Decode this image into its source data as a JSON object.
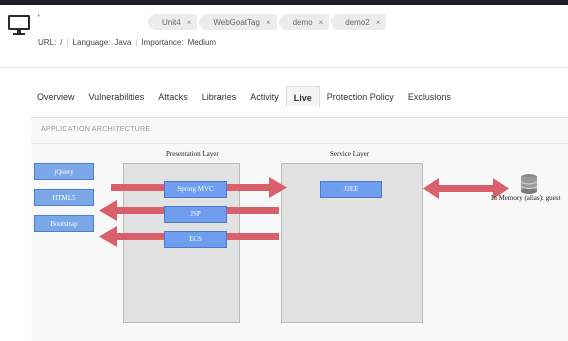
{
  "header": {
    "app_title": "'",
    "tags": [
      {
        "label": "Unit4"
      },
      {
        "label": "WebGoatTag"
      },
      {
        "label": "demo"
      },
      {
        "label": "demo2"
      }
    ],
    "url_label": "URL:",
    "url_value": "/",
    "language_label": "Language:",
    "language_value": "Java",
    "importance_label": "Importance:",
    "importance_value": "Medium"
  },
  "tabs": [
    {
      "label": "Overview",
      "active": false
    },
    {
      "label": "Vulnerabilities",
      "active": false
    },
    {
      "label": "Attacks",
      "active": false
    },
    {
      "label": "Libraries",
      "active": false
    },
    {
      "label": "Activity",
      "active": false
    },
    {
      "label": "Live",
      "active": true
    },
    {
      "label": "Protection Policy",
      "active": false
    },
    {
      "label": "Exclusions",
      "active": false
    }
  ],
  "architecture": {
    "title": "APPLICATION ARCHITECTURE",
    "libraries": [
      "jQuery",
      "HTML5",
      "Bootstrap"
    ],
    "presentation_layer": {
      "title": "Presentation Layer",
      "components": [
        "Spring MVC",
        "JSP",
        "ECS"
      ]
    },
    "service_layer": {
      "title": "Service Layer",
      "components": [
        "J2EE"
      ]
    },
    "database": {
      "label": "In Memory (alias): guest",
      "icon": "database-icon"
    },
    "colors": {
      "arrow": "#d9606b",
      "component": "#6f9ef0",
      "layer": "#e2e2e2"
    }
  }
}
